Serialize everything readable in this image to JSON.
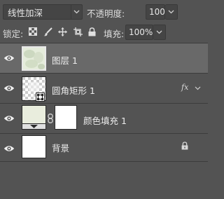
{
  "toolbar": {
    "blend_mode": "线性加深",
    "opacity_label": "不透明度:",
    "opacity_value": "100%",
    "lock_label": "锁定:",
    "fill_label": "填充:",
    "fill_value": "100%"
  },
  "layers": [
    {
      "name": "图层 1",
      "selected": true
    },
    {
      "name": "圆角矩形 1",
      "effect_badge": "fx"
    },
    {
      "name": "颜色填充 1"
    },
    {
      "name": "背景",
      "locked": true
    }
  ],
  "colors": {
    "panel_bg": "#535353",
    "selected_bg": "#696969",
    "separator": "#3c3c3c",
    "fill_color": "#e9eddd"
  }
}
